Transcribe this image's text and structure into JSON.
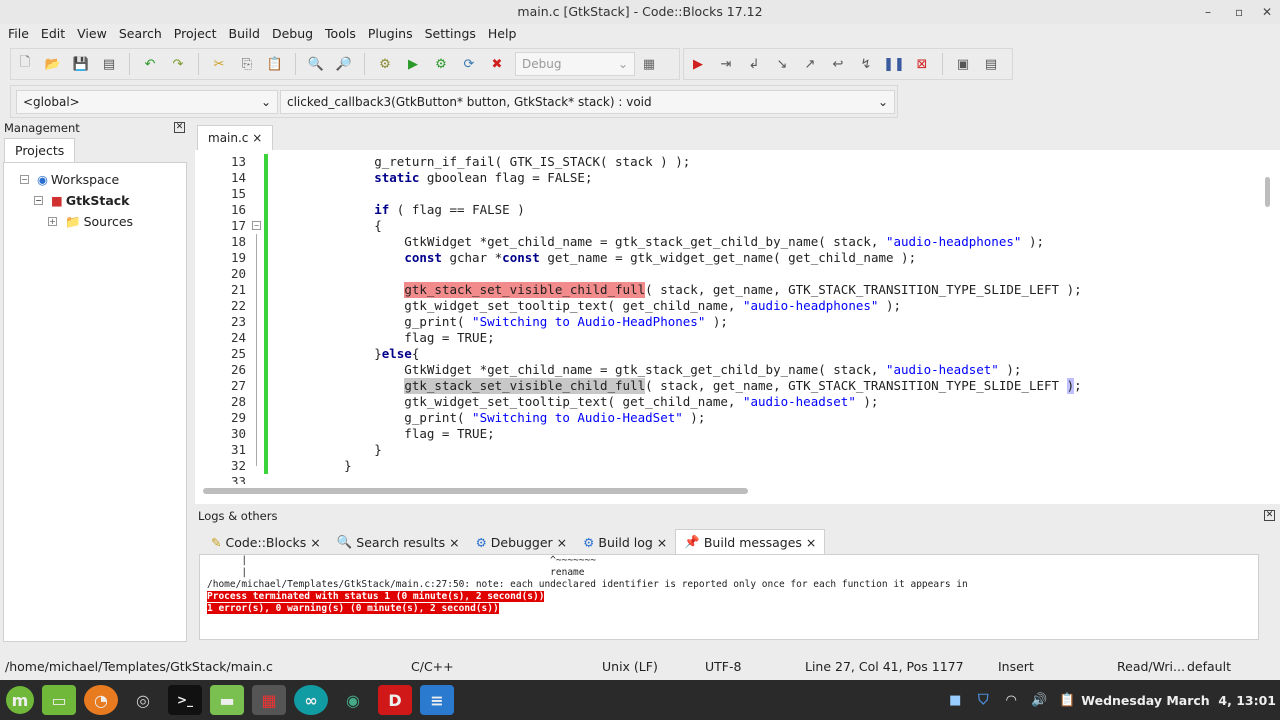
{
  "window": {
    "title": "main.c [GtkStack] - Code::Blocks 17.12"
  },
  "menu": [
    "File",
    "Edit",
    "View",
    "Search",
    "Project",
    "Build",
    "Debug",
    "Tools",
    "Plugins",
    "Settings",
    "Help"
  ],
  "toolbar": {
    "build_target": "Debug"
  },
  "scope": {
    "left": "<global>",
    "right": "clicked_callback3(GtkButton* button, GtkStack* stack) : void"
  },
  "management": {
    "title": "Management",
    "tab": "Projects",
    "tree": [
      "Workspace",
      "GtkStack",
      "Sources"
    ]
  },
  "editor": {
    "tab": "main.c",
    "close": "×",
    "lines": [
      {
        "n": "13",
        "seg": [
          [
            "        g_return_if_fail( GTK_IS_STACK( stack ) );",
            ""
          ]
        ]
      },
      {
        "n": "14",
        "seg": [
          [
            "        ",
            ""
          ],
          [
            "static",
            "kw"
          ],
          [
            " gboolean flag = FALSE;",
            ""
          ]
        ]
      },
      {
        "n": "15",
        "seg": []
      },
      {
        "n": "16",
        "seg": [
          [
            "        ",
            ""
          ],
          [
            "if",
            "kw"
          ],
          [
            " ( flag == FALSE )",
            ""
          ]
        ]
      },
      {
        "n": "17",
        "seg": [
          [
            "        {",
            ""
          ]
        ]
      },
      {
        "n": "18",
        "seg": [
          [
            "            GtkWidget *get_child_name = gtk_stack_get_child_by_name( stack, ",
            ""
          ],
          [
            "\"audio-headphones\"",
            "str"
          ],
          [
            " );",
            ""
          ]
        ]
      },
      {
        "n": "19",
        "seg": [
          [
            "            ",
            ""
          ],
          [
            "const",
            "kw"
          ],
          [
            " gchar *",
            ""
          ],
          [
            "const",
            "kw"
          ],
          [
            " get_name = gtk_widget_get_name( get_child_name );",
            ""
          ]
        ]
      },
      {
        "n": "20",
        "seg": []
      },
      {
        "n": "21",
        "seg": [
          [
            "            ",
            ""
          ],
          [
            "gtk_stack_set_visible_child_full",
            "hlr"
          ],
          [
            "( stack, get_name, GTK_STACK_TRANSITION_TYPE_SLIDE_LEFT );",
            ""
          ]
        ]
      },
      {
        "n": "22",
        "seg": [
          [
            "            gtk_widget_set_tooltip_text( get_child_name, ",
            ""
          ],
          [
            "\"audio-headphones\"",
            "str"
          ],
          [
            " );",
            ""
          ]
        ]
      },
      {
        "n": "23",
        "seg": [
          [
            "            g_print( ",
            ""
          ],
          [
            "\"Switching to Audio-HeadPhones\"",
            "str"
          ],
          [
            " );",
            ""
          ]
        ]
      },
      {
        "n": "24",
        "seg": [
          [
            "            flag = TRUE;",
            ""
          ]
        ]
      },
      {
        "n": "25",
        "seg": [
          [
            "        }",
            ""
          ],
          [
            "else",
            "kw"
          ],
          [
            "{",
            ""
          ]
        ]
      },
      {
        "n": "26",
        "seg": [
          [
            "            GtkWidget *get_child_name = gtk_stack_get_child_by_name( stack, ",
            ""
          ],
          [
            "\"audio-headset\"",
            "str"
          ],
          [
            " );",
            ""
          ]
        ]
      },
      {
        "n": "27",
        "seg": [
          [
            "            ",
            ""
          ],
          [
            "gtk_stack_set_visible_child_full",
            "hlg"
          ],
          [
            "( stack, get_name, GTK_STACK_TRANSITION_TYPE_SLIDE_LEFT ",
            ""
          ],
          [
            ")",
            "brm"
          ],
          [
            ";",
            ""
          ]
        ]
      },
      {
        "n": "28",
        "seg": [
          [
            "            gtk_widget_set_tooltip_text( get_child_name, ",
            ""
          ],
          [
            "\"audio-headset\"",
            "str"
          ],
          [
            " );",
            ""
          ]
        ]
      },
      {
        "n": "29",
        "seg": [
          [
            "            g_print( ",
            ""
          ],
          [
            "\"Switching to Audio-HeadSet\"",
            "str"
          ],
          [
            " );",
            ""
          ]
        ]
      },
      {
        "n": "30",
        "seg": [
          [
            "            flag = TRUE;",
            ""
          ]
        ]
      },
      {
        "n": "31",
        "seg": [
          [
            "        }",
            ""
          ]
        ]
      },
      {
        "n": "32",
        "seg": [
          [
            "    }",
            ""
          ]
        ]
      },
      {
        "n": "33",
        "seg": []
      }
    ]
  },
  "logs": {
    "title": "Logs & others",
    "tabs": [
      "Code::Blocks",
      "Search results",
      "Debugger",
      "Build log",
      "Build messages"
    ],
    "lines": [
      "      |                                                     ^~~~~~~~",
      "      |                                                     rename",
      "/home/michael/Templates/GtkStack/main.c:27:50: note: each undeclared identifier is reported only once for each function it appears in"
    ],
    "errors": [
      "Process terminated with status 1 (0 minute(s), 2 second(s))",
      "1 error(s), 0 warning(s) (0 minute(s), 2 second(s))"
    ]
  },
  "status": {
    "path": "/home/michael/Templates/GtkStack/main.c",
    "lang": "C/C++",
    "eol": "Unix (LF)",
    "enc": "UTF-8",
    "pos": "Line 27, Col 41, Pos 1177",
    "mode": "Insert",
    "rw": "Read/Wri...",
    "profile": "default"
  },
  "taskbar": {
    "clock": "Wednesday March  4, 13:01"
  }
}
